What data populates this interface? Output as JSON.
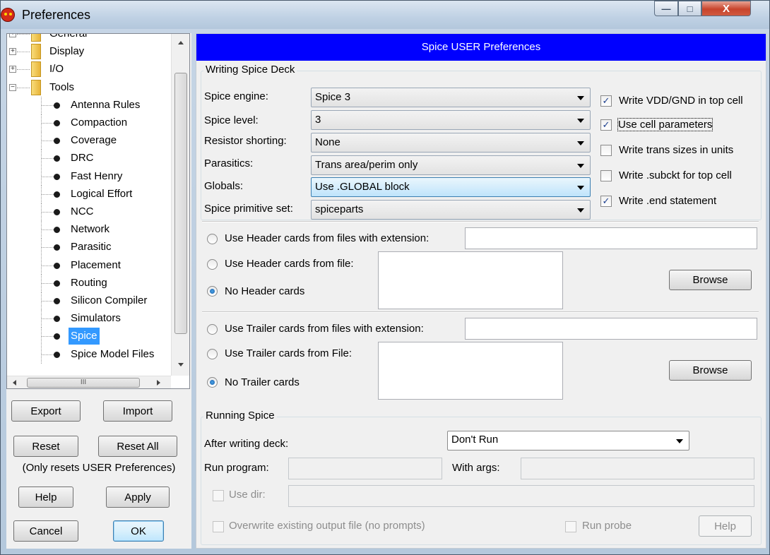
{
  "window": {
    "title": "Preferences",
    "controls": {
      "minimize": "—",
      "maximize": "□",
      "close": "X"
    }
  },
  "tree": {
    "scroll_h_grip": "III",
    "items": [
      {
        "label": "General",
        "type": "folder",
        "expander": "+"
      },
      {
        "label": "Display",
        "type": "folder",
        "expander": "+"
      },
      {
        "label": "I/O",
        "type": "folder",
        "expander": "+"
      },
      {
        "label": "Tools",
        "type": "folder",
        "expander": "−"
      },
      {
        "label": "Antenna Rules",
        "type": "leaf"
      },
      {
        "label": "Compaction",
        "type": "leaf"
      },
      {
        "label": "Coverage",
        "type": "leaf"
      },
      {
        "label": "DRC",
        "type": "leaf"
      },
      {
        "label": "Fast Henry",
        "type": "leaf"
      },
      {
        "label": "Logical Effort",
        "type": "leaf"
      },
      {
        "label": "NCC",
        "type": "leaf"
      },
      {
        "label": "Network",
        "type": "leaf"
      },
      {
        "label": "Parasitic",
        "type": "leaf"
      },
      {
        "label": "Placement",
        "type": "leaf"
      },
      {
        "label": "Routing",
        "type": "leaf"
      },
      {
        "label": "Silicon Compiler",
        "type": "leaf"
      },
      {
        "label": "Simulators",
        "type": "leaf"
      },
      {
        "label": "Spice",
        "type": "leaf",
        "selected": true
      },
      {
        "label": "Spice Model Files",
        "type": "leaf"
      }
    ]
  },
  "left_buttons": {
    "export": "Export",
    "import": "Import",
    "reset": "Reset",
    "reset_all": "Reset All",
    "reset_note": "(Only resets USER Preferences)",
    "help": "Help",
    "apply": "Apply",
    "cancel": "Cancel",
    "ok": "OK"
  },
  "panel": {
    "header": "Spice USER Preferences",
    "writing": {
      "title": "Writing Spice Deck",
      "engine_label": "Spice engine:",
      "engine_value": "Spice 3",
      "level_label": "Spice level:",
      "level_value": "3",
      "resistor_label": "Resistor shorting:",
      "resistor_value": "None",
      "parasitics_label": "Parasitics:",
      "parasitics_value": "Trans area/perim only",
      "globals_label": "Globals:",
      "globals_value": "Use .GLOBAL block",
      "primitive_label": "Spice primitive set:",
      "primitive_value": "spiceparts",
      "checks": [
        {
          "label": "Write VDD/GND in top cell",
          "checked": true
        },
        {
          "label": "Use cell parameters",
          "checked": true
        },
        {
          "label": "Write trans sizes in units",
          "checked": false
        },
        {
          "label": "Write .subckt for top cell",
          "checked": false
        },
        {
          "label": "Write .end statement",
          "checked": true
        }
      ]
    },
    "header_cards": {
      "opt_ext": "Use Header cards from files with extension:",
      "opt_file": "Use Header cards from file:",
      "opt_none": "No Header cards",
      "browse": "Browse",
      "selected": "none"
    },
    "trailer_cards": {
      "opt_ext": "Use Trailer cards from files with extension:",
      "opt_file": "Use Trailer cards from File:",
      "opt_none": "No Trailer cards",
      "browse": "Browse",
      "selected": "none"
    },
    "running": {
      "title": "Running Spice",
      "after_label": "After writing deck:",
      "after_value": "Don't Run",
      "run_program_label": "Run program:",
      "with_args_label": "With args:",
      "use_dir_label": "Use dir:",
      "overwrite_label": "Overwrite existing output file (no prompts)",
      "run_probe_label": "Run probe",
      "help": "Help"
    }
  },
  "colors": {
    "header_bg": "#0000ff",
    "selection": "#3399ff"
  }
}
